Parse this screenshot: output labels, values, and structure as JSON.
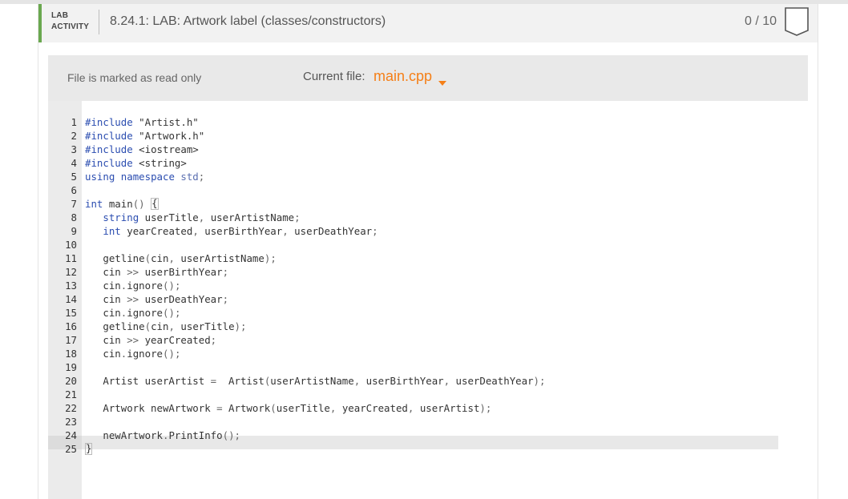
{
  "header": {
    "tag_line1": "LAB",
    "tag_line2": "ACTIVITY",
    "title": "8.24.1: LAB: Artwork label (classes/constructors)",
    "score": "0 / 10"
  },
  "editor": {
    "readonly_label": "File is marked as read only",
    "current_file_label": "Current file:",
    "current_file": "main.cpp",
    "accent_color": "#f57f17",
    "active_line": 25
  },
  "code_lines": [
    "#include \"Artist.h\"",
    "#include \"Artwork.h\"",
    "#include <iostream>",
    "#include <string>",
    "using namespace std;",
    "",
    "int main() {",
    "   string userTitle, userArtistName;",
    "   int yearCreated, userBirthYear, userDeathYear;",
    "",
    "   getline(cin, userArtistName);",
    "   cin >> userBirthYear;",
    "   cin.ignore();",
    "   cin >> userDeathYear;",
    "   cin.ignore();",
    "   getline(cin, userTitle);",
    "   cin >> yearCreated;",
    "   cin.ignore();",
    "",
    "   Artist userArtist =  Artist(userArtistName, userBirthYear, userDeathYear);",
    "",
    "   Artwork newArtwork = Artwork(userTitle, yearCreated, userArtist);",
    "",
    "   newArtwork.PrintInfo();",
    "}"
  ]
}
